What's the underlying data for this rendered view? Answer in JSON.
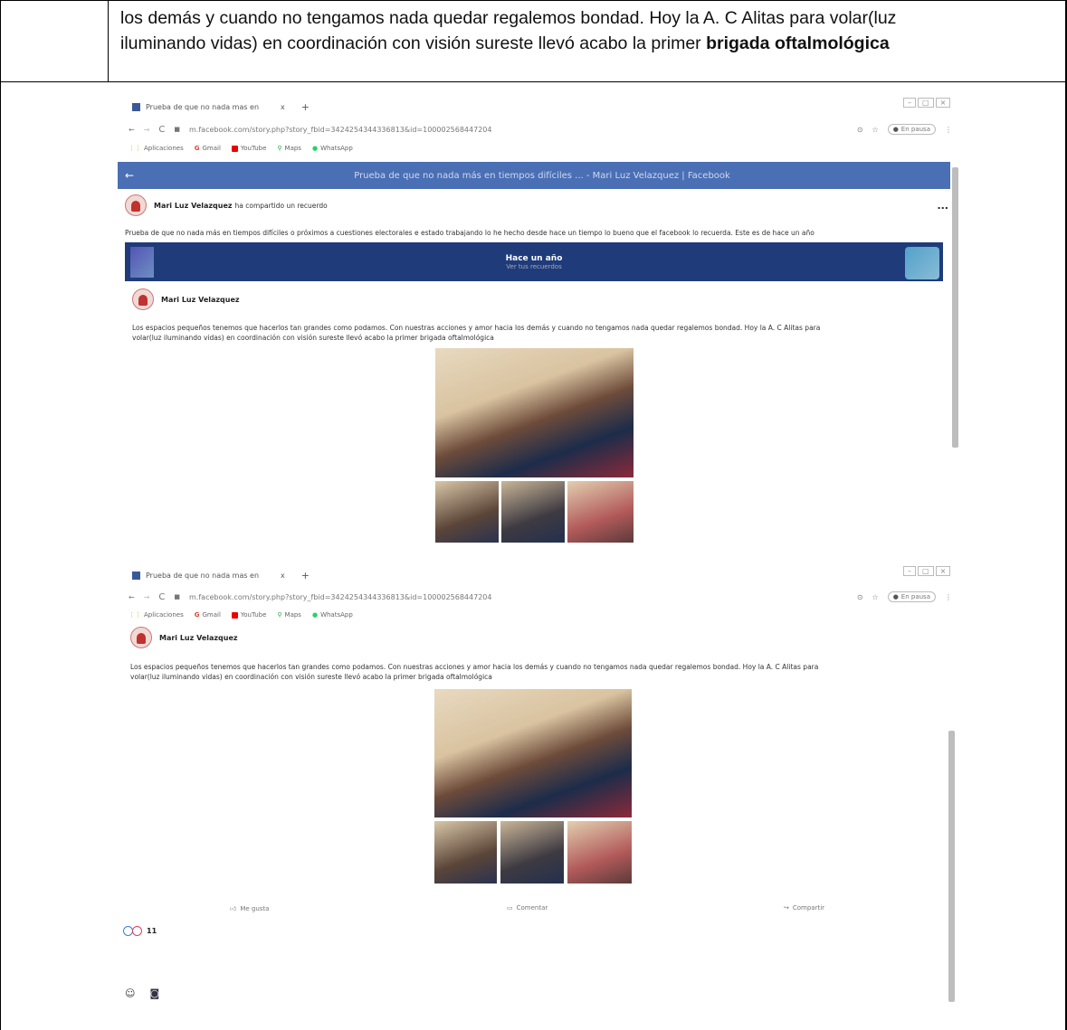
{
  "document": {
    "line1": "los demás y cuando no tengamos nada quedar regalemos bondad. Hoy la A. C Alitas para volar(luz",
    "line2_plain": "iluminando vidas) en coordinación con visión sureste llevó acabo la primer ",
    "line2_bold": "brigada oftalmológica"
  },
  "shot1": {
    "tab_title": "Prueba de que no nada mas en",
    "tab_close": "x",
    "tab_new": "+",
    "url": "m.facebook.com/story.php?story_fbid=3424254344336813&id=100002568447204",
    "bookmarks": [
      "Aplicaciones",
      "Gmail",
      "YouTube",
      "Maps",
      "WhatsApp"
    ],
    "paused": "En pausa",
    "fb_title": "Prueba de que no nada más en tiempos difíciles ... - Mari Luz Velazquez | Facebook",
    "poster": "Mari Luz Velazquez",
    "shared": "ha compartido un recuerdo",
    "intro": "Prueba de que no nada más en tiempos difíciles o próximos a cuestiones electorales e estado trabajando lo he hecho desde hace un tiempo lo bueno que el facebook lo recuerda. Este es de hace un año",
    "memory_title": "Hace un año",
    "memory_sub": "Ver tus recuerdos",
    "inner_name": "Mari Luz Velazquez",
    "post_l1": "Los espacios pequeños tenemos que hacerlos tan grandes como podamos. Con nuestras acciones y amor hacia los demás y cuando no tengamos nada quedar regalemos bondad. Hoy la A. C Alitas para",
    "post_l2": "volar(luz iluminando vidas) en coordinación con visión sureste llevó acabo la primer brigada oftalmológica",
    "more": "..."
  },
  "shot2": {
    "tab_title": "Prueba de que no nada mas en",
    "tab_close": "x",
    "tab_new": "+",
    "url": "m.facebook.com/story.php?story_fbid=3424254344336813&id=100002568447204",
    "bookmarks": [
      "Aplicaciones",
      "Gmail",
      "YouTube",
      "Maps",
      "WhatsApp"
    ],
    "paused": "En pausa",
    "inner_name": "Mari Luz Velazquez",
    "post_l1": "Los espacios pequeños tenemos que hacerlos tan grandes como podamos. Con nuestras acciones y amor hacia los demás y cuando no tengamos nada quedar regalemos bondad. Hoy la A. C Alitas para",
    "post_l2": "volar(luz iluminando vidas) en coordinación con visión sureste llevó acabo la primer brigada oftalmológica",
    "like": "Me gusta",
    "comment": "Comentar",
    "share": "Compartir",
    "reactions": "11"
  },
  "colors": {
    "fb_blue": "#4a6fb5",
    "memory_bg": "#1f3b7a"
  }
}
